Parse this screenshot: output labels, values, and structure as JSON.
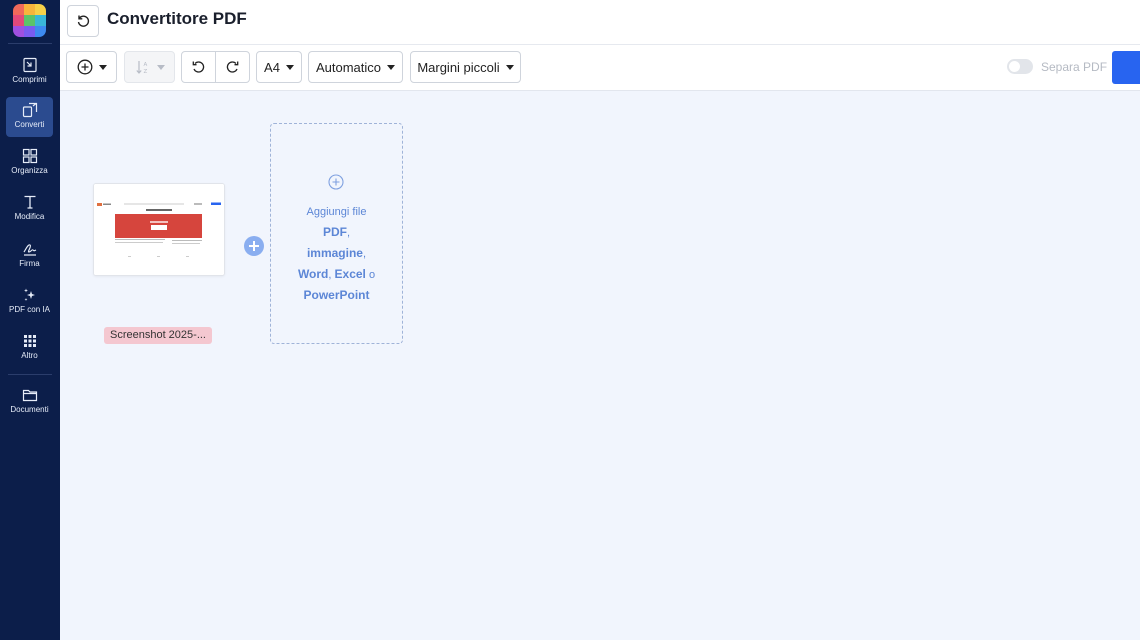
{
  "sidebar": {
    "items": [
      {
        "label": "Comprimi",
        "icon": "compress-icon"
      },
      {
        "label": "Converti",
        "icon": "convert-icon",
        "active": true
      },
      {
        "label": "Organizza",
        "icon": "organize-icon"
      },
      {
        "label": "Modifica",
        "icon": "edit-text-icon"
      },
      {
        "label": "Firma",
        "icon": "signature-icon"
      },
      {
        "label": "PDF con IA",
        "icon": "sparkle-icon"
      },
      {
        "label": "Altro",
        "icon": "grid-dots-icon"
      },
      {
        "label": "Documenti",
        "icon": "folder-icon"
      }
    ]
  },
  "header": {
    "title": "Convertitore PDF"
  },
  "toolbar": {
    "page_size": "A4",
    "orientation": "Automatico",
    "margins": "Margini piccoli",
    "separate_toggle_label": "Separa PDF",
    "accent_color": "#2864f0"
  },
  "workspace": {
    "file": {
      "name": "Screenshot 2025-..."
    },
    "drop_zone": {
      "line1": "Aggiungi file",
      "pdf": "PDF",
      "image": "immagine",
      "word": "Word",
      "excel": "Excel",
      "or": "o",
      "powerpoint": "PowerPoint"
    }
  }
}
